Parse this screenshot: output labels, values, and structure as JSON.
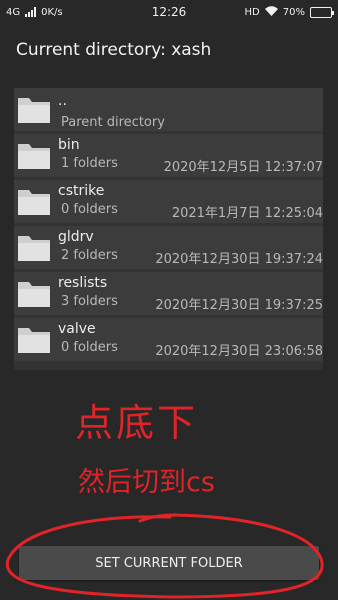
{
  "status_bar": {
    "network": "4G",
    "speed": "0K/s",
    "time": "12:26",
    "hd": "HD",
    "battery_text": "70%",
    "battery_level": 0.7
  },
  "title": "Current directory: xash",
  "parent": {
    "name": "..",
    "label": "Parent directory"
  },
  "folders": [
    {
      "name": "bin",
      "count": "1 folders",
      "date": "2020年12月5日 12:37:07"
    },
    {
      "name": "cstrike",
      "count": "0 folders",
      "date": "2021年1月7日 12:25:04"
    },
    {
      "name": "gldrv",
      "count": "2 folders",
      "date": "2020年12月30日 19:37:24"
    },
    {
      "name": "reslists",
      "count": "3 folders",
      "date": "2020年12月30日 19:37:25"
    },
    {
      "name": "valve",
      "count": "0 folders",
      "date": "2020年12月30日 23:06:58"
    }
  ],
  "annotation": {
    "line1": "点底下",
    "line2": "然后切到cs"
  },
  "button": {
    "label": "SET CURRENT FOLDER"
  },
  "colors": {
    "background": "#282828",
    "row": "#3c3c3c",
    "annotation": "#e02428"
  }
}
